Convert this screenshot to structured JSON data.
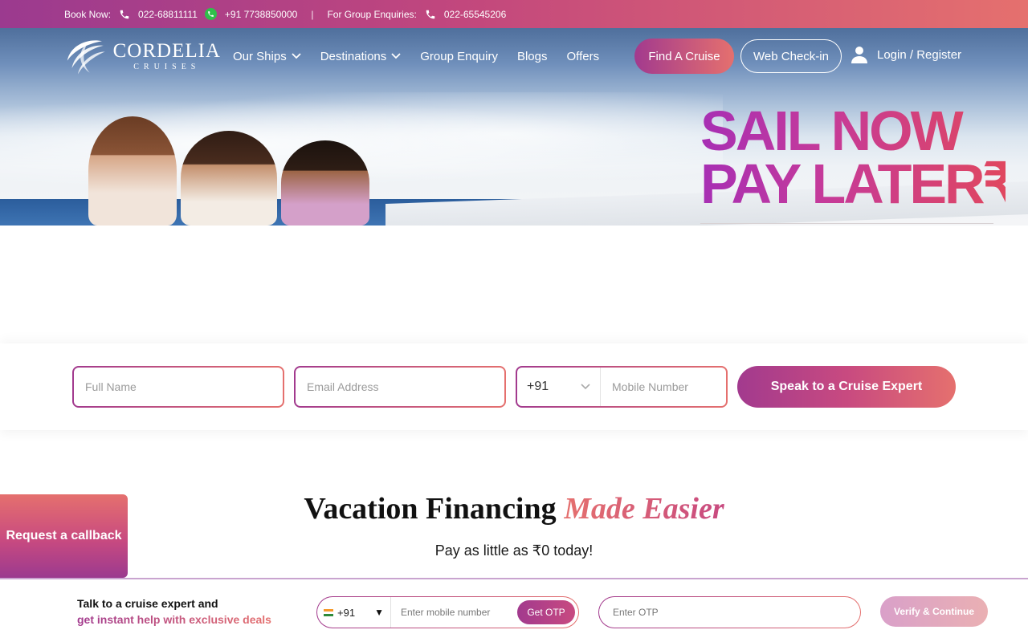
{
  "topbar": {
    "book_now_label": "Book Now:",
    "phone_primary": "022-68811111",
    "whatsapp_number": "+91 7738850000",
    "separator": "|",
    "group_label": "For Group Enquiries:",
    "group_phone": "022-65545206"
  },
  "brand": {
    "name": "CORDELIA",
    "tagline": "CRUISES"
  },
  "nav": {
    "items": [
      {
        "label": "Our Ships",
        "has_dropdown": true
      },
      {
        "label": "Destinations",
        "has_dropdown": true
      },
      {
        "label": "Group Enquiry",
        "has_dropdown": false
      },
      {
        "label": "Blogs",
        "has_dropdown": false
      },
      {
        "label": "Offers",
        "has_dropdown": false
      }
    ],
    "find_cruise_label": "Find A Cruise",
    "web_checkin_label": "Web Check-in",
    "login_label": "Login / Register"
  },
  "promo": {
    "line1": "SAIL NOW",
    "line2": "PAY LATER₹"
  },
  "lead_form": {
    "name_placeholder": "Full Name",
    "email_placeholder": "Email Address",
    "country_code": "+91",
    "mobile_placeholder": "Mobile Number",
    "submit_label": "Speak to a Cruise Expert"
  },
  "callback": {
    "label": "Request a callback"
  },
  "section": {
    "title_main": "Vacation Financing",
    "title_accent": "Made Easier",
    "subtitle": "Pay as little as ₹0 today!"
  },
  "bottom_bar": {
    "line1": "Talk to a cruise expert and",
    "line2": "get instant help with exclusive deals",
    "country_code": "+91",
    "mobile_placeholder": "Enter mobile number",
    "get_otp_label": "Get OTP",
    "otp_placeholder": "Enter OTP",
    "verify_label": "Verify & Continue"
  },
  "colors": {
    "brand_gradient_start": "#9b3a8f",
    "brand_gradient_end": "#e5706e",
    "whatsapp": "#2fbf4a"
  },
  "icons": [
    "phone-icon",
    "whatsapp-icon",
    "chevron-down-icon",
    "user-icon",
    "india-flag-icon",
    "caret-down-icon"
  ]
}
